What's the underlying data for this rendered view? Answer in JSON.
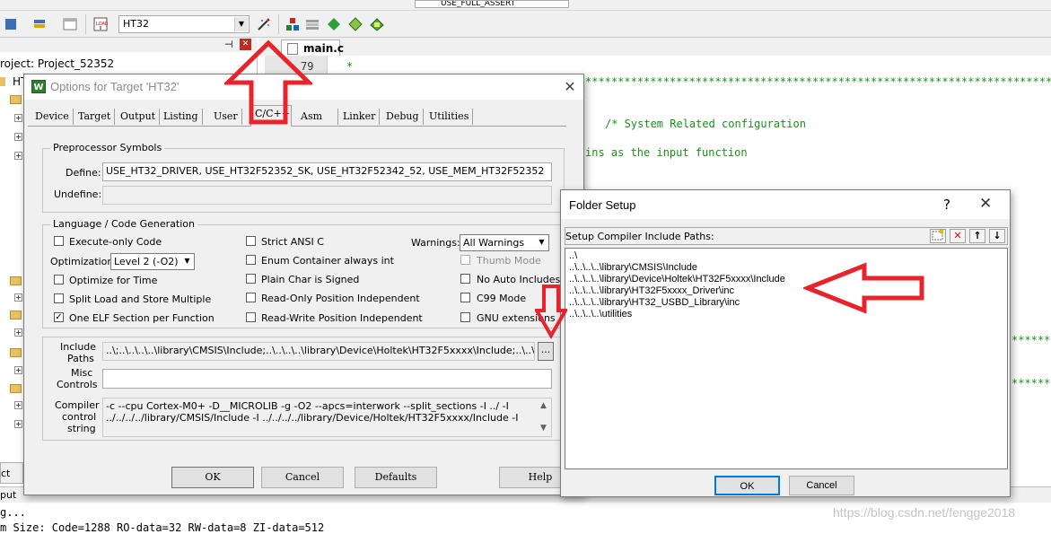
{
  "toolbar": {
    "target_name": "HT32",
    "top_combo_value": "USE_FULL_ASSERT"
  },
  "project": {
    "panel_root_label": "roject: Project_52352",
    "first_group_label": "HT"
  },
  "editor": {
    "tab_label": "main.c",
    "line_number": "79",
    "line_79_code": "*",
    "stars_line": "**************************************************************************************************************************************************************",
    "comment_system": "/* System Related configuration",
    "comment_pins": "ins as the input function",
    "stars_short": "**************************"
  },
  "output": {
    "tab_label": "ct",
    "header_label": "put",
    "line1": "g...",
    "line2": "m Size: Code=1288 RO-data=32 RW-data=8 ZI-data=512"
  },
  "watermark": "https://blog.csdn.net/fengge2018",
  "options_dialog": {
    "title": "Options for Target 'HT32'",
    "tabs": [
      "Device",
      "Target",
      "Output",
      "Listing",
      "User",
      "C/C++",
      "Asm",
      "Linker",
      "Debug",
      "Utilities"
    ],
    "active_tab": "C/C++",
    "preprocessor": {
      "group_title": "Preprocessor Symbols",
      "define_label": "Define:",
      "define_value": "USE_HT32_DRIVER, USE_HT32F52352_SK, USE_HT32F52342_52, USE_MEM_HT32F52352",
      "undefine_label": "Undefine:",
      "undefine_value": ""
    },
    "language": {
      "group_title": "Language / Code Generation",
      "execute_only": "Execute-only Code",
      "optimization_label": "Optimization:",
      "optimization_value": "Level 2 (-O2)",
      "optimize_time": "Optimize for Time",
      "split_load": "Split Load and Store Multiple",
      "one_elf": "One ELF Section per Function",
      "strict_ansi": "Strict ANSI C",
      "enum_container": "Enum Container always int",
      "plain_char": "Plain Char is Signed",
      "ro_pi": "Read-Only Position Independent",
      "rw_pi": "Read-Write Position Independent",
      "warnings_label": "Warnings:",
      "warnings_value": "All Warnings",
      "thumb_mode": "Thumb Mode",
      "no_auto_includes": "No Auto Includes",
      "c99_mode": "C99 Mode",
      "gnu_extensions": "GNU extensions",
      "checkmark": "✓"
    },
    "include_paths_label_1": "Include",
    "include_paths_label_2": "Paths",
    "include_paths_value": "..\\;..\\..\\..\\..\\library\\CMSIS\\Include;..\\..\\..\\..\\library\\Device\\Holtek\\HT32F5xxxx\\Include;..\\..\\..\\..\\library",
    "browse_label": "...",
    "misc_label_1": "Misc",
    "misc_label_2": "Controls",
    "misc_value": "",
    "compiler_label_1": "Compiler",
    "compiler_label_2": "control",
    "compiler_label_3": "string",
    "compiler_line1": "-c --cpu Cortex-M0+ -D__MICROLIB -g -O2 --apcs=interwork --split_sections -I ../ -I",
    "compiler_line2": "../../../../library/CMSIS/Include -I ../../../../library/Device/Holtek/HT32F5xxxx/Include -I",
    "ok_label": "OK",
    "cancel_label": "Cancel",
    "defaults_label": "Defaults",
    "help_label": "Help"
  },
  "folder_dialog": {
    "title": "Folder Setup",
    "help_glyph": "?",
    "close_glyph": "✕",
    "header_label": "Setup Compiler Include Paths:",
    "paths": [
      "..\\",
      "..\\..\\..\\..\\library\\CMSIS\\Include",
      "..\\..\\..\\..\\library\\Device\\Holtek\\HT32F5xxxx\\Include",
      "..\\..\\..\\..\\library\\HT32F5xxxx_Driver\\inc",
      "..\\..\\..\\..\\library\\HT32_USBD_Library\\inc",
      "..\\..\\..\\..\\utilities"
    ],
    "ok_label": "OK",
    "cancel_label": "Cancel"
  },
  "colors": {
    "annotation_red": "#e8232b",
    "code_green": "#1a8f1a"
  }
}
